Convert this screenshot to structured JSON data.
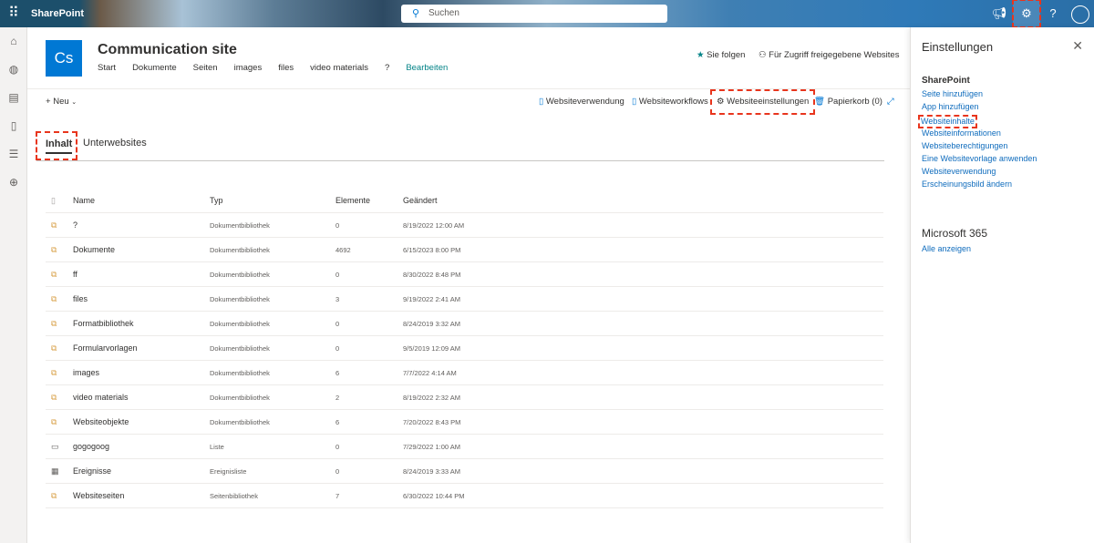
{
  "topbar": {
    "app": "SharePoint",
    "search_placeholder": "Suchen"
  },
  "site": {
    "logo": "Cs",
    "title": "Communication site",
    "nav": [
      "Start",
      "Dokumente",
      "Seiten",
      "images",
      "files",
      "video materials",
      "?"
    ],
    "edit": "Bearbeiten",
    "follow": "Sie folgen",
    "shared": "Für Zugriff freigegebene Websites"
  },
  "commands": {
    "new": "Neu",
    "usage": "Websiteverwendung",
    "workflows": "Websiteworkflows",
    "settings": "Websiteeinstellungen",
    "recycle": "Papierkorb (0)"
  },
  "tabs": [
    "Inhalt",
    "Unterwebsites"
  ],
  "table": {
    "headers": [
      "Name",
      "Typ",
      "Elemente",
      "Geändert"
    ],
    "rows": [
      {
        "name": "?",
        "type": "Dokumentbibliothek",
        "items": "0",
        "modified": "8/19/2022 12:00 AM",
        "icon": "library"
      },
      {
        "name": "Dokumente",
        "type": "Dokumentbibliothek",
        "items": "4692",
        "modified": "6/15/2023 8:00 PM",
        "icon": "library"
      },
      {
        "name": "ff",
        "type": "Dokumentbibliothek",
        "items": "0",
        "modified": "8/30/2022 8:48 PM",
        "icon": "library"
      },
      {
        "name": "files",
        "type": "Dokumentbibliothek",
        "items": "3",
        "modified": "9/19/2022 2:41 AM",
        "icon": "library"
      },
      {
        "name": "Formatbibliothek",
        "type": "Dokumentbibliothek",
        "items": "0",
        "modified": "8/24/2019 3:32 AM",
        "icon": "library"
      },
      {
        "name": "Formularvorlagen",
        "type": "Dokumentbibliothek",
        "items": "0",
        "modified": "9/5/2019 12:09 AM",
        "icon": "library"
      },
      {
        "name": "images",
        "type": "Dokumentbibliothek",
        "items": "6",
        "modified": "7/7/2022 4:14 AM",
        "icon": "library"
      },
      {
        "name": "video materials",
        "type": "Dokumentbibliothek",
        "items": "2",
        "modified": "8/19/2022 2:32 AM",
        "icon": "library"
      },
      {
        "name": "Websiteobjekte",
        "type": "Dokumentbibliothek",
        "items": "6",
        "modified": "7/20/2022 8:43 PM",
        "icon": "library"
      },
      {
        "name": "gogogoog",
        "type": "Liste",
        "items": "0",
        "modified": "7/29/2022 1:00 AM",
        "icon": "list"
      },
      {
        "name": "Ereignisse",
        "type": "Ereignisliste",
        "items": "0",
        "modified": "8/24/2019 3:33 AM",
        "icon": "calendar"
      },
      {
        "name": "Websiteseiten",
        "type": "Seitenbibliothek",
        "items": "7",
        "modified": "6/30/2022 10:44 PM",
        "icon": "library"
      }
    ]
  },
  "panel": {
    "title": "Einstellungen",
    "sharepoint": "SharePoint",
    "links": [
      "Seite hinzufügen",
      "App hinzufügen",
      "Websiteinhalte",
      "Websiteinformationen",
      "Websiteberechtigungen",
      "Eine Websitevorlage anwenden",
      "Websiteverwendung",
      "Erscheinungsbild ändern"
    ],
    "m365": "Microsoft 365",
    "all": "Alle anzeigen"
  }
}
